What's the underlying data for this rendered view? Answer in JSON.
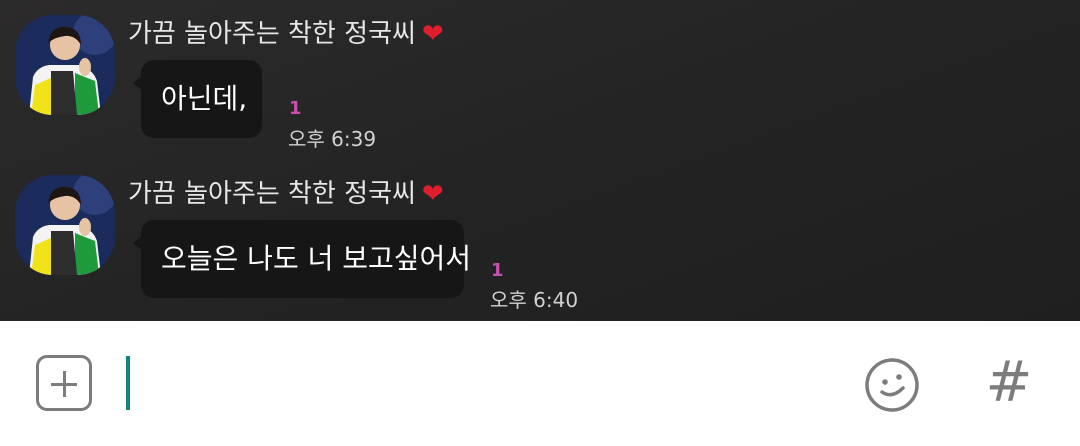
{
  "messages": [
    {
      "sender": "가끔 놀아주는 착한 정국씨",
      "sender_heart": "❤",
      "text": "아닌데,",
      "unread": "1",
      "time": "오후 6:39"
    },
    {
      "sender": "가끔 놀아주는 착한 정국씨",
      "sender_heart": "❤",
      "text": "오늘은 나도 너 보고싶어서",
      "unread": "1",
      "time": "오후 6:40"
    }
  ],
  "input_bar": {
    "text_value": "",
    "add_icon": "plus-square-icon",
    "emoji_icon": "smiley-icon",
    "hash_icon": "hash-icon",
    "hash_glyph": "#"
  },
  "colors": {
    "chat_background": "#262626",
    "bubble": "#161616",
    "unread": "#c94fb0",
    "heart": "#e01e2e",
    "cursor": "#14857a"
  }
}
